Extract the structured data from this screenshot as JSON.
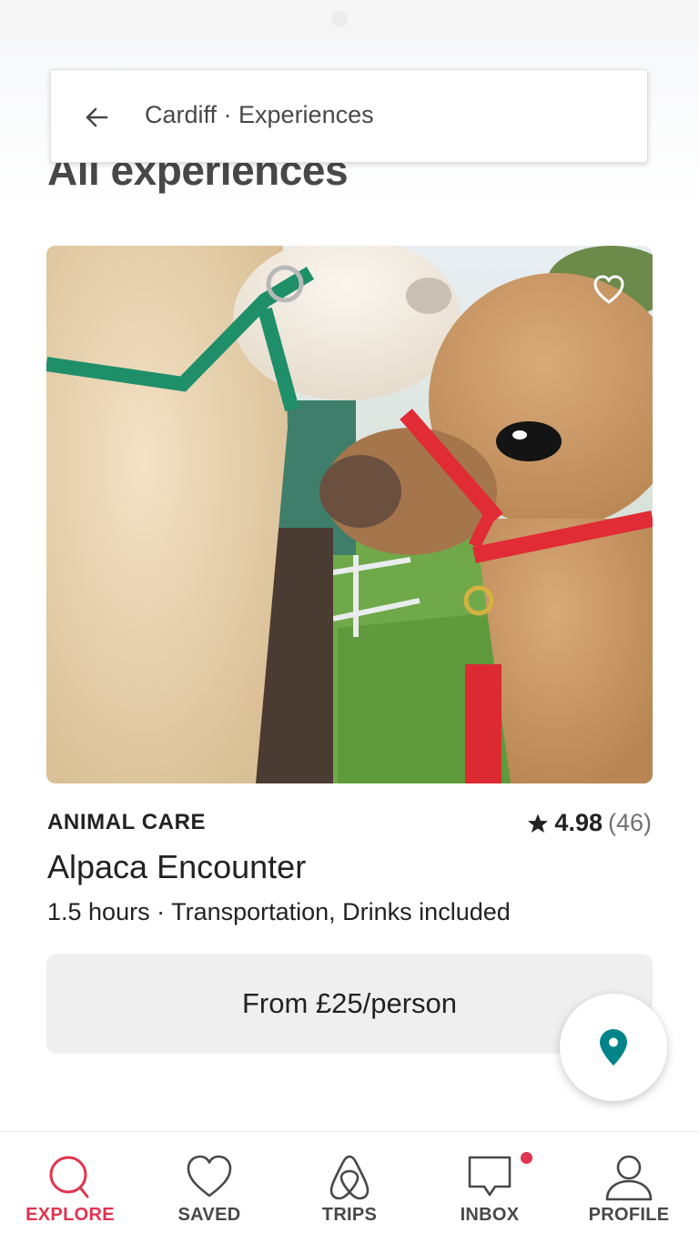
{
  "header": {
    "search_text": "Cardiff · Experiences",
    "section_title": "All experiences"
  },
  "listing": {
    "category": "ANIMAL CARE",
    "rating": "4.98",
    "review_count": "(46)",
    "title": "Alpaca Encounter",
    "details": "1.5 hours · Transportation, Drinks included",
    "price_label": "From £25/person",
    "saved": false
  },
  "nav": {
    "items": [
      {
        "label": "EXPLORE",
        "icon": "search-icon",
        "active": true
      },
      {
        "label": "SAVED",
        "icon": "heart-icon",
        "active": false
      },
      {
        "label": "TRIPS",
        "icon": "airbnb-logo-icon",
        "active": false
      },
      {
        "label": "INBOX",
        "icon": "chat-icon",
        "active": false,
        "has_notification": true
      },
      {
        "label": "PROFILE",
        "icon": "person-icon",
        "active": false
      }
    ]
  },
  "colors": {
    "accent": "#e0344f",
    "map_pin": "#008489",
    "text": "#222222",
    "muted": "#717171"
  }
}
